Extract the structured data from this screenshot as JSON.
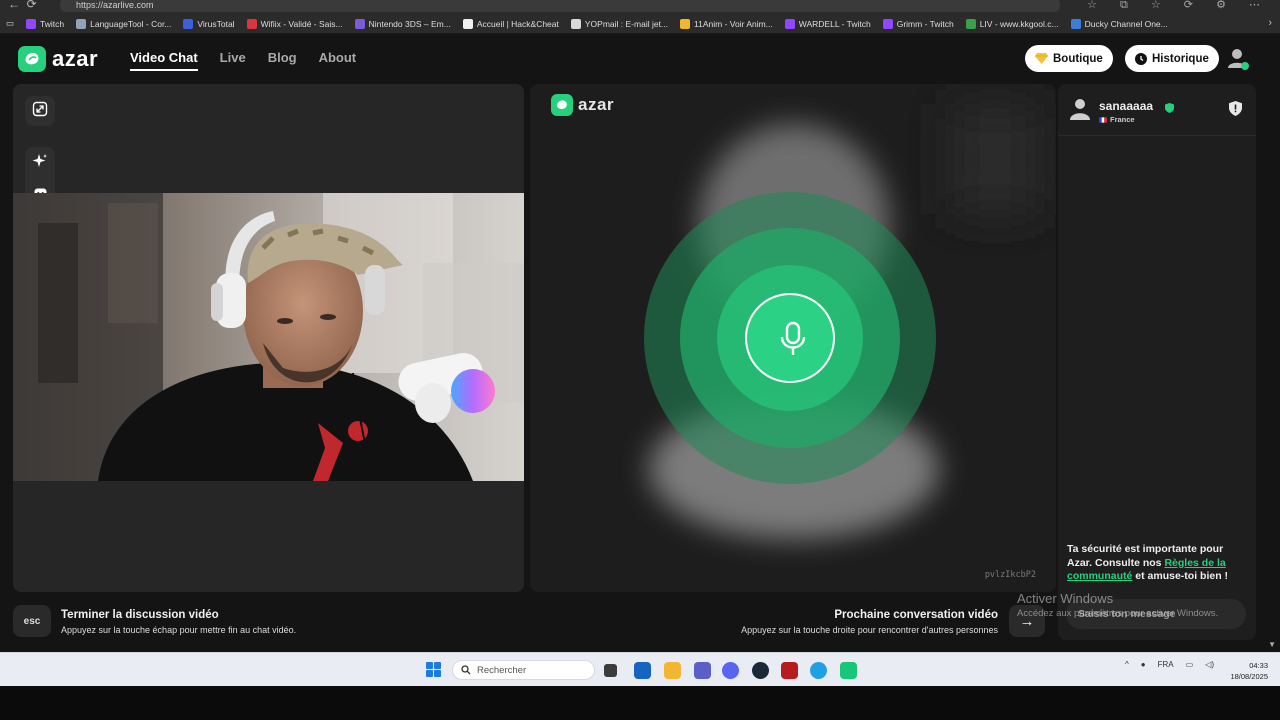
{
  "browser": {
    "url": "https://azarlive.com",
    "bookmarks": [
      {
        "label": "Twitch",
        "color": "#9146ff"
      },
      {
        "label": "LanguageTool - Cor...",
        "color": "#8ea4b8"
      },
      {
        "label": "VirusTotal",
        "color": "#3b61d9"
      },
      {
        "label": "Wifiix - Validé - Sais...",
        "color": "#d9363e"
      },
      {
        "label": "Nintendo 3DS – Em...",
        "color": "#7b5cd6"
      },
      {
        "label": "Accueil | Hack&Cheat",
        "color": "#f1f1f1"
      },
      {
        "label": "YOPmail : E-mail jet...",
        "color": "#d9d9d9"
      },
      {
        "label": "11Anim - Voir Anim...",
        "color": "#f2b631"
      },
      {
        "label": "WARDELL - Twitch",
        "color": "#9146ff"
      },
      {
        "label": "Grimm - Twitch",
        "color": "#9146ff"
      },
      {
        "label": "LIV - www.kkgool.c...",
        "color": "#3aa04a"
      },
      {
        "label": "Ducky Channel One...",
        "color": "#3b7dd8"
      }
    ]
  },
  "header": {
    "brand": "azar",
    "nav": [
      {
        "label": "Video Chat",
        "active": true
      },
      {
        "label": "Live",
        "active": false
      },
      {
        "label": "Blog",
        "active": false
      },
      {
        "label": "About",
        "active": false
      }
    ],
    "boutique_label": "Boutique",
    "historique_label": "Historique"
  },
  "middle": {
    "brand": "azar",
    "room_id": "pvlzIkcbP2",
    "accent": "#27d07d"
  },
  "peer": {
    "name": "sanaaaaa",
    "country": "France"
  },
  "safety": {
    "text_before": "Ta sécurité est importante pour Azar. Consulte nos ",
    "link": "Règles de la communauté",
    "text_after": " et amuse-toi bien !"
  },
  "chat": {
    "placeholder": "Saisis ton message"
  },
  "hints": {
    "esc_key": "esc",
    "end_title": "Terminer la discussion vidéo",
    "end_sub": "Appuyez sur la touche échap pour mettre fin au chat vidéo.",
    "next_title": "Prochaine conversation vidéo",
    "next_sub": "Appuyez sur la touche droite pour rencontrer d'autres personnes"
  },
  "watermark": {
    "line1": "Activer Windows",
    "line2": "Accédez aux paramètres pour activer Windows."
  },
  "taskbar": {
    "search_label": "Rechercher",
    "language": "FRA",
    "time": "04:33",
    "date": "18/08/2025"
  }
}
